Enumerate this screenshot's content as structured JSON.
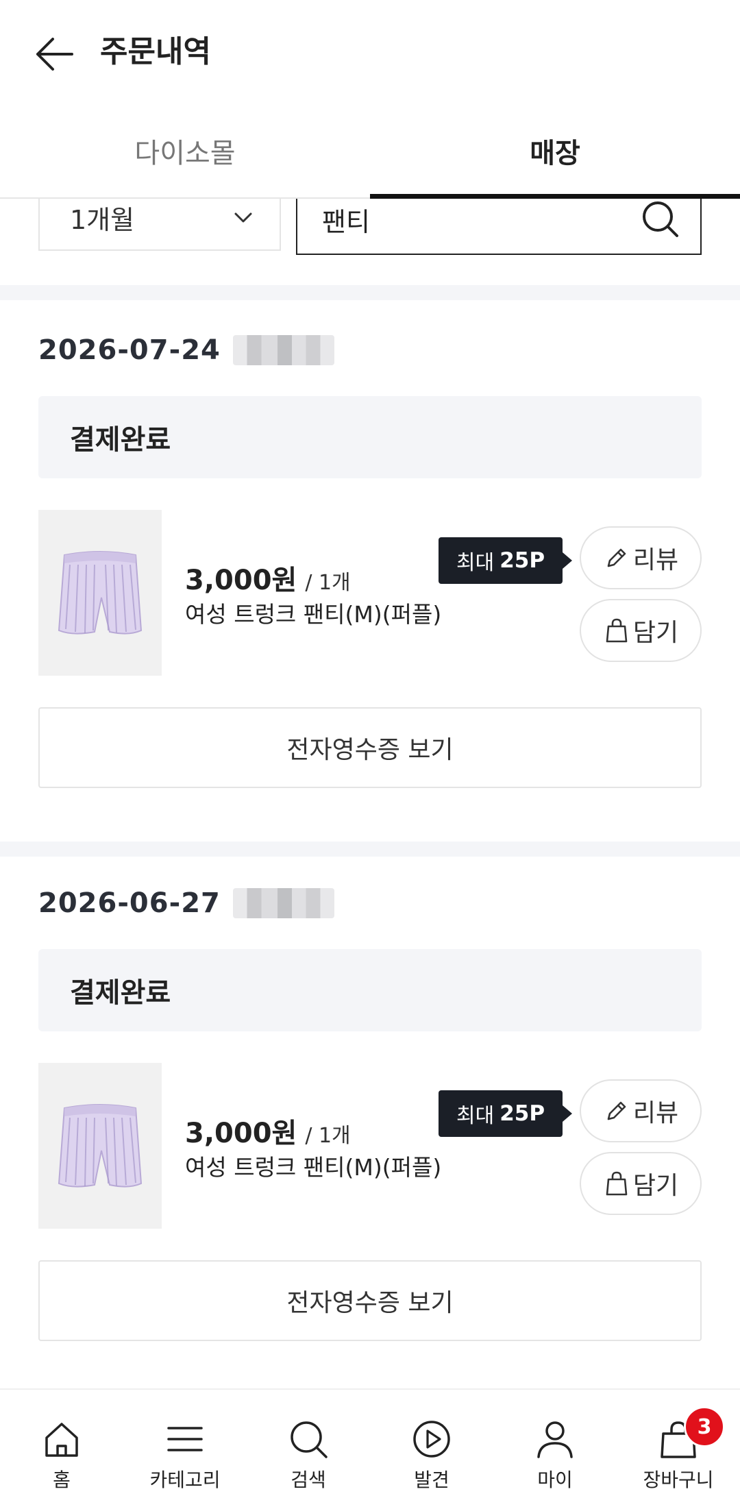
{
  "header": {
    "title": "주문내역"
  },
  "tabs": [
    {
      "label": "다이소몰",
      "active": false
    },
    {
      "label": "매장",
      "active": true
    }
  ],
  "filter": {
    "period": "1개월",
    "search_value": "팬티"
  },
  "orders": [
    {
      "date": "2026-07-24",
      "status": "결제완료",
      "item": {
        "price": "3,000원",
        "qty": "/ 1개",
        "name": "여성 트렁크 팬티(M)(퍼플)",
        "points_prefix": "최대",
        "points": "25P"
      },
      "review_label": "리뷰",
      "cart_label": "담기",
      "receipt_label": "전자영수증 보기"
    },
    {
      "date": "2026-06-27",
      "status": "결제완료",
      "item": {
        "price": "3,000원",
        "qty": "/ 1개",
        "name": "여성 트렁크 팬티(M)(퍼플)",
        "points_prefix": "최대",
        "points": "25P"
      },
      "review_label": "리뷰",
      "cart_label": "담기",
      "receipt_label": "전자영수증 보기"
    }
  ],
  "bottom_nav": {
    "items": [
      {
        "label": "홈",
        "icon": "home-icon"
      },
      {
        "label": "카테고리",
        "icon": "menu-icon"
      },
      {
        "label": "검색",
        "icon": "search-icon"
      },
      {
        "label": "발견",
        "icon": "play-icon"
      },
      {
        "label": "마이",
        "icon": "person-icon"
      },
      {
        "label": "장바구니",
        "icon": "cart-icon"
      }
    ],
    "cart_count": "3"
  },
  "colors": {
    "accent_dark": "#1b1f27",
    "badge_red": "#e1111b",
    "panel_bg": "#f4f5f8"
  }
}
